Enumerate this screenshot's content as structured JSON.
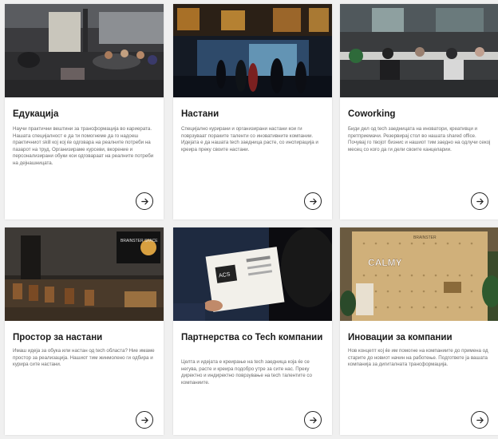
{
  "cards": [
    {
      "title": "Едукација",
      "description": "Научи практични вештини за трансформација во кариерата. Нашата специјалност е да ти помогнеме да го надоеш практичниот skill кој кој ќе одговара на реалните потреби на пазарот на труд. Организираме курсеви, вкорение и персонализирани обуки кои одговараат на реалните потреби на дејнашницата.",
      "arrow_icon": "arrow-right-icon"
    },
    {
      "title": "Настани",
      "description": "Специјално курирани и организирани настани кои ги поврзуваат пораките таленти со иновативните компании. Идејата е да нашата tech заедница расте, со инспирација и креира преку своите настани.",
      "arrow_icon": "arrow-right-icon"
    },
    {
      "title": "Coworking",
      "description": "Биди дел од tech заедницата на иноватори, креативци и претприемачи. Резервирај стол во нашата shared office. Почувај го твојот бизнис и нашиот тим заедно на одлучи секој месец со кого да ги дели своите канцеларии.",
      "arrow_icon": "arrow-right-icon"
    },
    {
      "title": "Простор за настани",
      "description": "Имаш идеја за обука или настан од tech областа? Ние имаме простор за реализација. Нашиот тим жинмолено ги одбира и курира сите настани.",
      "arrow_icon": "arrow-right-icon"
    },
    {
      "title": "Партнерства со Tech компании",
      "description": "Целта и идејата е креирање на tech заедница која ќе се негува, расте и креира подобро утре за сите нас. Преку директно и индиректно поврзување на tech талентите со компаниите.",
      "arrow_icon": "arrow-right-icon"
    },
    {
      "title": "Иновации за компании",
      "description": "Нов концепт кој ќе им помогне на компаниите до примена од старите до новиот начин на работење. Подгответе ја вашата компанија за дигиталната трансформација.",
      "arrow_icon": "arrow-right-icon"
    }
  ],
  "photo_texts": {
    "screen_text": "BRAINSTER SPACE",
    "book_text": "ACS",
    "sign_text": "CALMY",
    "top_sign": "BRAINSTER"
  }
}
